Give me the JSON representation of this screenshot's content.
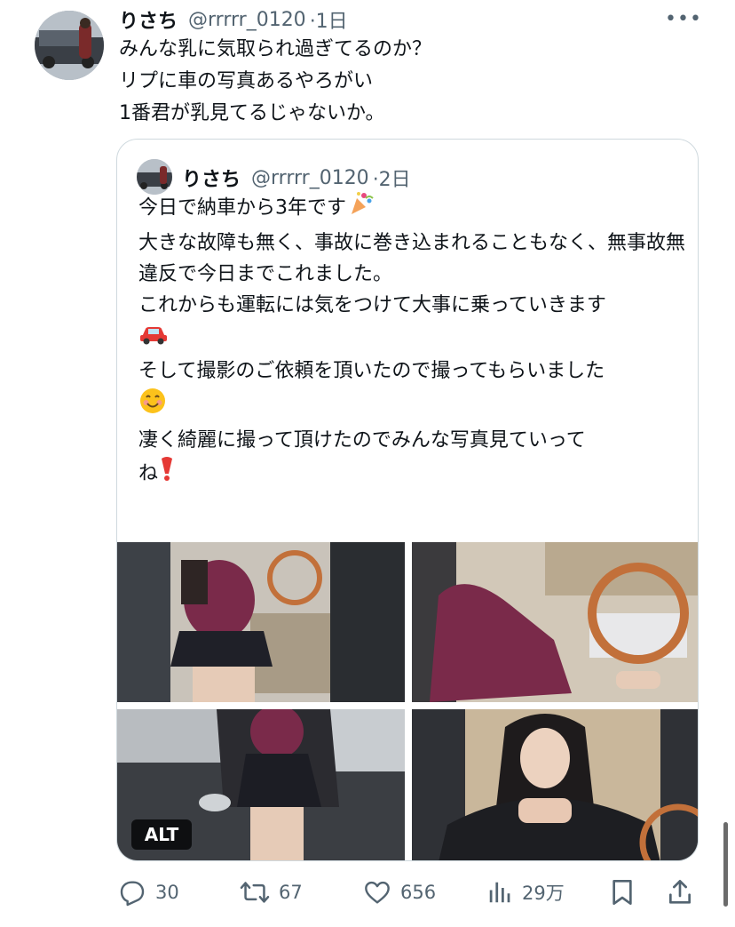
{
  "tweet": {
    "author_name": "りさち",
    "author_handle": "@rrrrr_0120",
    "time": "·1日",
    "text": "みんな乳に気取られ過ぎてるのか？\nリプに車の写真あるやろがい\n1番君が乳見てるじゃないか。",
    "more_label": "•••"
  },
  "quote": {
    "author_name": "りさち",
    "author_handle": "@rrrrr_0120",
    "time": "·2日",
    "line1": "今日で納車から3年です",
    "line2": "\n大きな故障も無く、事故に巻き込まれることもなく、無事故無違反で今日までこれました。\nこれからも運転には気をつけて大事に乗っていきます",
    "line3": "\nそして撮影のご依頼を頂いたので撮ってもらいました",
    "line4": "凄く綺麗に撮って頂けたのでみんな写真見ていって\nね",
    "alt_label": "ALT"
  },
  "actions": {
    "replies": "30",
    "retweets": "67",
    "likes": "656",
    "views": "29万"
  },
  "icons": {
    "reply": "reply-icon",
    "retweet": "retweet-icon",
    "like": "heart-icon",
    "views": "views-icon",
    "bookmark": "bookmark-icon",
    "share": "share-icon",
    "celebration": "party-popper-icon",
    "car": "car-icon",
    "smile": "smile-icon",
    "exclamation": "exclamation-icon"
  },
  "colors": {
    "text": "#0f1419",
    "secondary": "#536471",
    "border": "#cfd9de"
  }
}
